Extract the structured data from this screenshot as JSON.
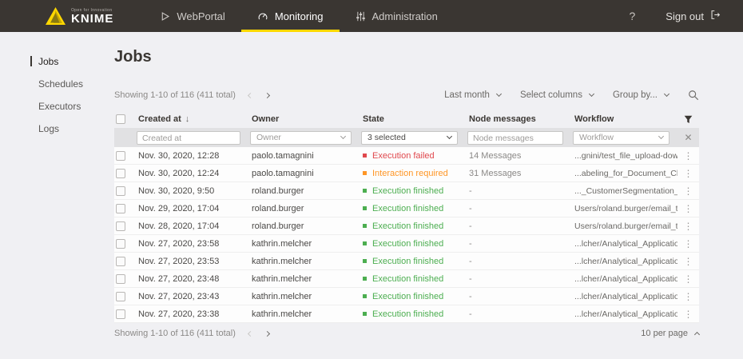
{
  "header": {
    "logo": {
      "tagline": "Open for Innovation",
      "brand": "KNIME"
    },
    "nav": [
      {
        "label": "WebPortal",
        "icon": "play-outline-icon",
        "active": false
      },
      {
        "label": "Monitoring",
        "icon": "gauge-icon",
        "active": true
      },
      {
        "label": "Administration",
        "icon": "sliders-icon",
        "active": false
      }
    ],
    "help_label": "?",
    "sign_out_label": "Sign out"
  },
  "sidebar": {
    "items": [
      {
        "label": "Jobs",
        "active": true
      },
      {
        "label": "Schedules",
        "active": false
      },
      {
        "label": "Executors",
        "active": false
      },
      {
        "label": "Logs",
        "active": false
      }
    ]
  },
  "main": {
    "title": "Jobs",
    "toolbar": {
      "showing_text": "Showing 1-10 of 116 (411 total)",
      "filters": [
        {
          "label": "Last month"
        },
        {
          "label": "Select columns"
        },
        {
          "label": "Group by..."
        }
      ]
    },
    "table": {
      "columns": {
        "created_at": "Created at",
        "owner": "Owner",
        "state": "State",
        "node_messages": "Node messages",
        "workflow": "Workflow"
      },
      "sort_arrow": "↓",
      "filter_row": {
        "created_at_placeholder": "Created at",
        "owner_placeholder": "Owner",
        "state_value": "3 selected",
        "node_messages_placeholder": "Node messages",
        "workflow_placeholder": "Workflow",
        "clear_label": "✕"
      },
      "kebab_glyph": "⋮",
      "rows": [
        {
          "created_at": "Nov. 30, 2020, 12:28",
          "owner": "paolo.tamagnini",
          "state": "Execution failed",
          "state_type": "failed",
          "node_messages": "14 Messages",
          "workflow": "...gnini/test_file_upload-download-fixed/"
        },
        {
          "created_at": "Nov. 30, 2020, 12:24",
          "owner": "paolo.tamagnini",
          "state": "Interaction required",
          "state_type": "interaction",
          "node_messages": "31 Messages",
          "workflow": "...abeling_for_Document_Classification/"
        },
        {
          "created_at": "Nov. 30, 2020, 9:50",
          "owner": "roland.burger",
          "state": "Execution finished",
          "state_type": "finished",
          "node_messages": "-",
          "workflow": "..._CustomerSegmentation_ScoringAPI/"
        },
        {
          "created_at": "Nov. 29, 2020, 17:04",
          "owner": "roland.burger",
          "state": "Execution finished",
          "state_type": "finished",
          "node_messages": "-",
          "workflow": "Users/roland.burger/email_test/"
        },
        {
          "created_at": "Nov. 28, 2020, 17:04",
          "owner": "roland.burger",
          "state": "Execution finished",
          "state_type": "finished",
          "node_messages": "-",
          "workflow": "Users/roland.burger/email_test/"
        },
        {
          "created_at": "Nov. 27, 2020, 23:58",
          "owner": "kathrin.melcher",
          "state": "Execution finished",
          "state_type": "finished",
          "node_messages": "-",
          "workflow": "...lcher/Analytical_Application_Example/"
        },
        {
          "created_at": "Nov. 27, 2020, 23:53",
          "owner": "kathrin.melcher",
          "state": "Execution finished",
          "state_type": "finished",
          "node_messages": "-",
          "workflow": "...lcher/Analytical_Application_Example/"
        },
        {
          "created_at": "Nov. 27, 2020, 23:48",
          "owner": "kathrin.melcher",
          "state": "Execution finished",
          "state_type": "finished",
          "node_messages": "-",
          "workflow": "...lcher/Analytical_Application_Example/"
        },
        {
          "created_at": "Nov. 27, 2020, 23:43",
          "owner": "kathrin.melcher",
          "state": "Execution finished",
          "state_type": "finished",
          "node_messages": "-",
          "workflow": "...lcher/Analytical_Application_Example/"
        },
        {
          "created_at": "Nov. 27, 2020, 23:38",
          "owner": "kathrin.melcher",
          "state": "Execution finished",
          "state_type": "finished",
          "node_messages": "-",
          "workflow": "...lcher/Analytical_Application_Example/"
        }
      ]
    },
    "footer": {
      "showing_text": "Showing 1-10 of 116 (411 total)",
      "per_page": "10 per page"
    }
  },
  "colors": {
    "header_bg": "#3a3632",
    "accent_yellow": "#ffd800",
    "state_failed": "#e0484d",
    "state_interaction": "#fe9626",
    "state_finished": "#4cae50",
    "filter_row_bg": "#e1e1e3",
    "page_bg": "#f0f0f3"
  }
}
